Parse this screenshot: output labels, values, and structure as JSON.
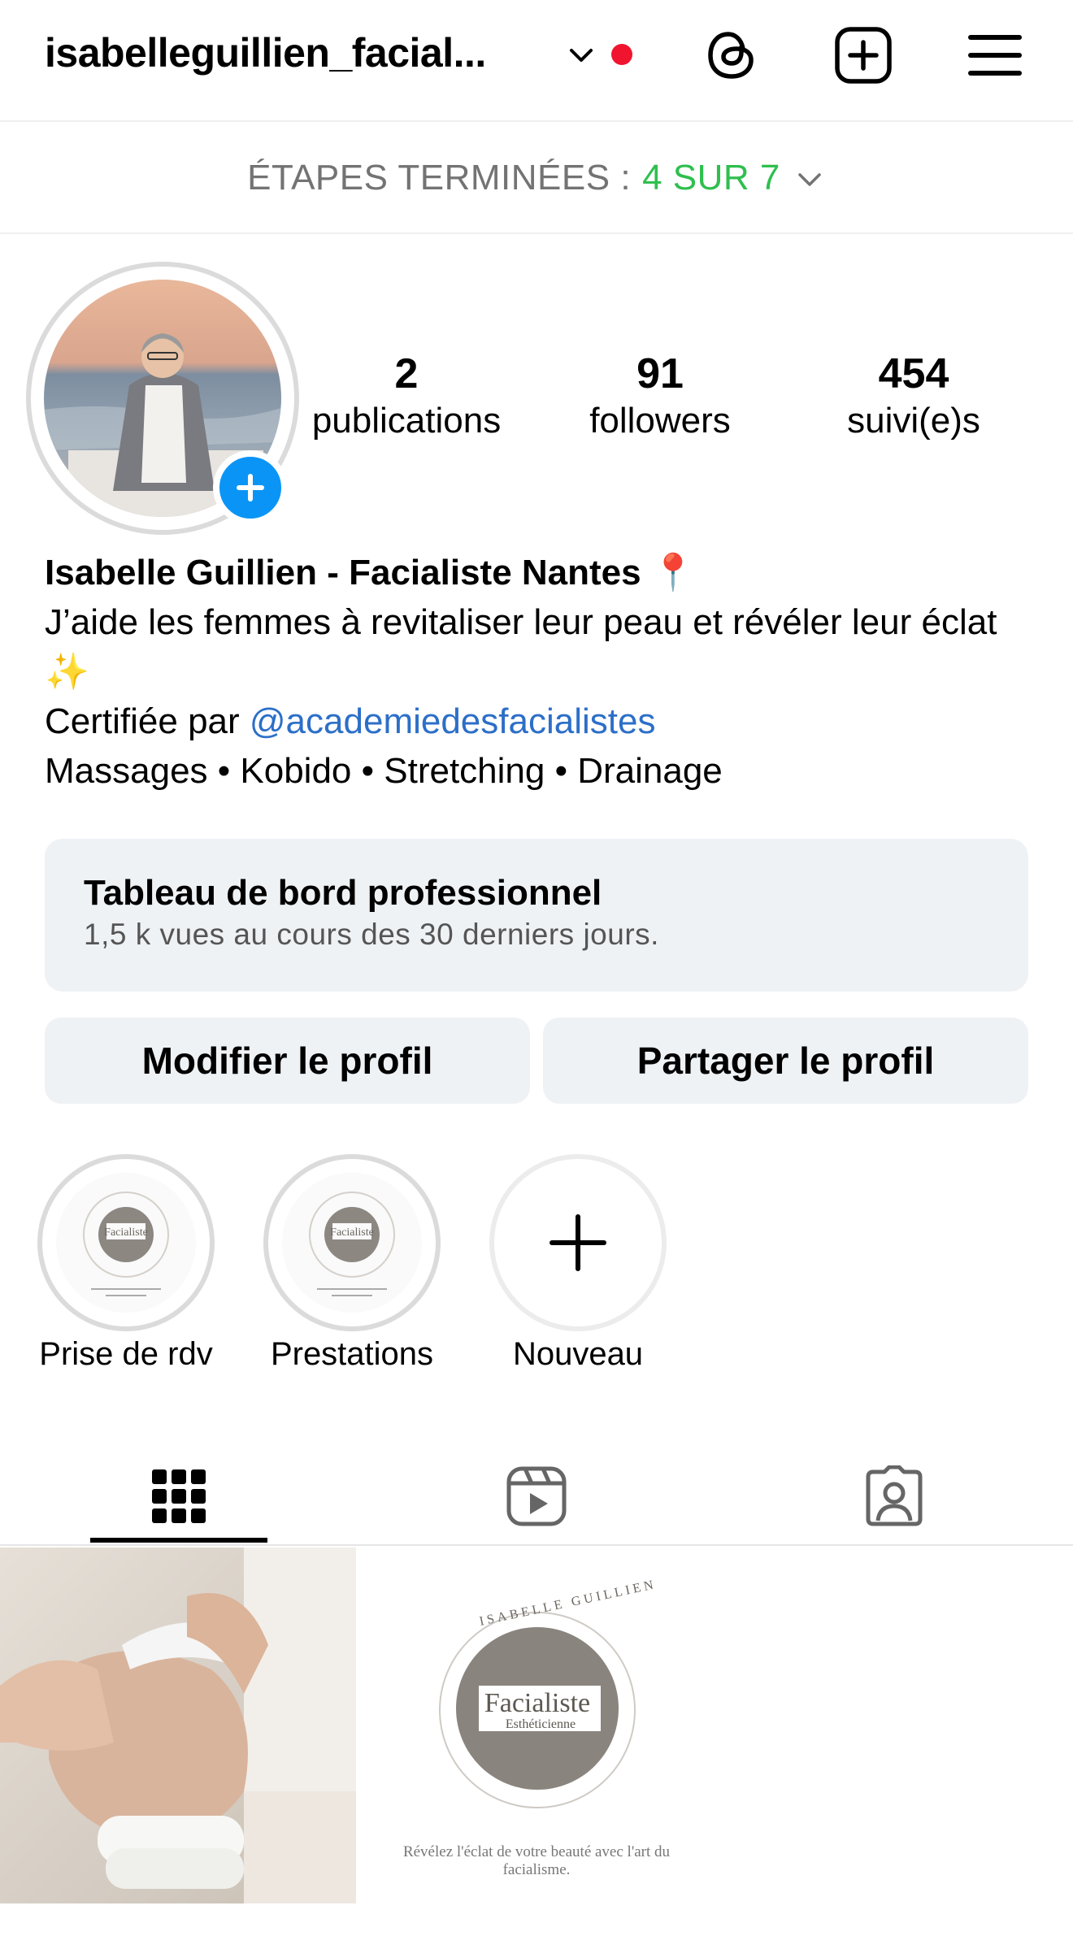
{
  "header": {
    "username": "isabelleguillien_facial...",
    "icons": [
      "chevron-down-icon",
      "threads-icon",
      "new-post-icon",
      "menu-icon"
    ],
    "notification_color": "#f0142f"
  },
  "steps": {
    "label": "ÉTAPES TERMINÉES :",
    "progress": "4 SUR 7",
    "completed": 4,
    "total": 7,
    "accent": "#2fbf4e"
  },
  "stats": [
    {
      "value": "2",
      "label": "publications"
    },
    {
      "value": "91",
      "label": "followers"
    },
    {
      "value": "454",
      "label": "suivi(e)s"
    }
  ],
  "bio": {
    "name": "Isabelle Guillien - Facialiste Nantes 📍",
    "line1": "J’aide les femmes à revitaliser leur peau et révéler leur éclat ✨",
    "certified_prefix": "Certifiée par ",
    "certified_link": "@academiedesfacialistes",
    "line3": "Massages • Kobido • Stretching • Drainage",
    "link_color": "#2c6fc8"
  },
  "dashboard": {
    "title": "Tableau de bord professionnel",
    "subtitle": "1,5 k vues au cours des 30 derniers jours."
  },
  "buttons": {
    "edit": "Modifier le profil",
    "share": "Partager le profil"
  },
  "highlights": [
    {
      "label": "Prise de rdv"
    },
    {
      "label": "Prestations"
    },
    {
      "label": "Nouveau"
    }
  ],
  "logo": {
    "arc_text": "ISABELLE GUILLIEN",
    "word": "Facialiste",
    "sub": "Esthéticienne",
    "tagline_1": "Révélez l'éclat de votre beauté avec l'art du",
    "tagline_2": "facialisme."
  },
  "tabs": [
    {
      "name": "grid-icon",
      "active": true
    },
    {
      "name": "reels-icon",
      "active": false
    },
    {
      "name": "tagged-icon",
      "active": false
    }
  ]
}
